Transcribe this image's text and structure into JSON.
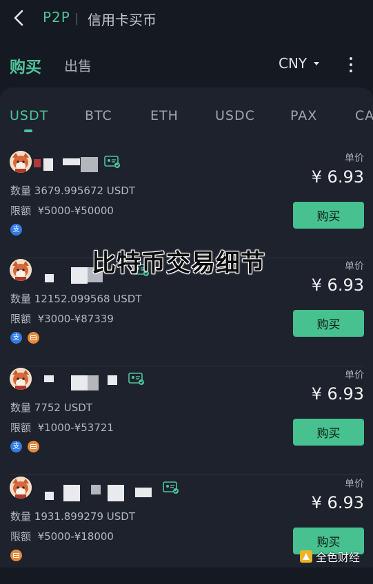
{
  "header": {
    "brand": "P2P",
    "title": "信用卡买币"
  },
  "modes": {
    "buy": "购买",
    "sell": "出售"
  },
  "currency": "CNY",
  "tabs": [
    "USDT",
    "BTC",
    "ETH",
    "USDC",
    "PAX",
    "CA"
  ],
  "active_tab": "USDT",
  "listings": [
    {
      "quantity_label": "数量",
      "quantity": "3679.995672 USDT",
      "limit_label": "限额",
      "limit": "¥5000-¥50000",
      "unit_label": "单价",
      "price": "¥ 6.93",
      "button": "购买",
      "payments": [
        "支"
      ]
    },
    {
      "quantity_label": "数量",
      "quantity": "12152.099568 USDT",
      "limit_label": "限额",
      "limit": "¥3000-¥87339",
      "unit_label": "单价",
      "price": "¥ 6.93",
      "button": "购买",
      "payments": [
        "支",
        "bank-card-icon"
      ]
    },
    {
      "quantity_label": "数量",
      "quantity": "7752 USDT",
      "limit_label": "限额",
      "limit": "¥1000-¥53721",
      "unit_label": "单价",
      "price": "¥ 6.93",
      "button": "购买",
      "payments": [
        "支",
        "bank-card-icon"
      ]
    },
    {
      "quantity_label": "数量",
      "quantity": "1931.899279 USDT",
      "limit_label": "限额",
      "limit": "¥5000-¥18000",
      "unit_label": "单价",
      "price": "¥ 6.93",
      "button": "购买",
      "payments": [
        "bank-card-icon"
      ]
    }
  ],
  "watermark": "比特币交易细节",
  "brand_mark": "全色财经",
  "colors": {
    "accent": "#4fc39a",
    "button": "#46c18f",
    "background": "#151922",
    "panel": "#1d222c",
    "alipay": "#2f7be8",
    "bank": "#e8893b"
  }
}
